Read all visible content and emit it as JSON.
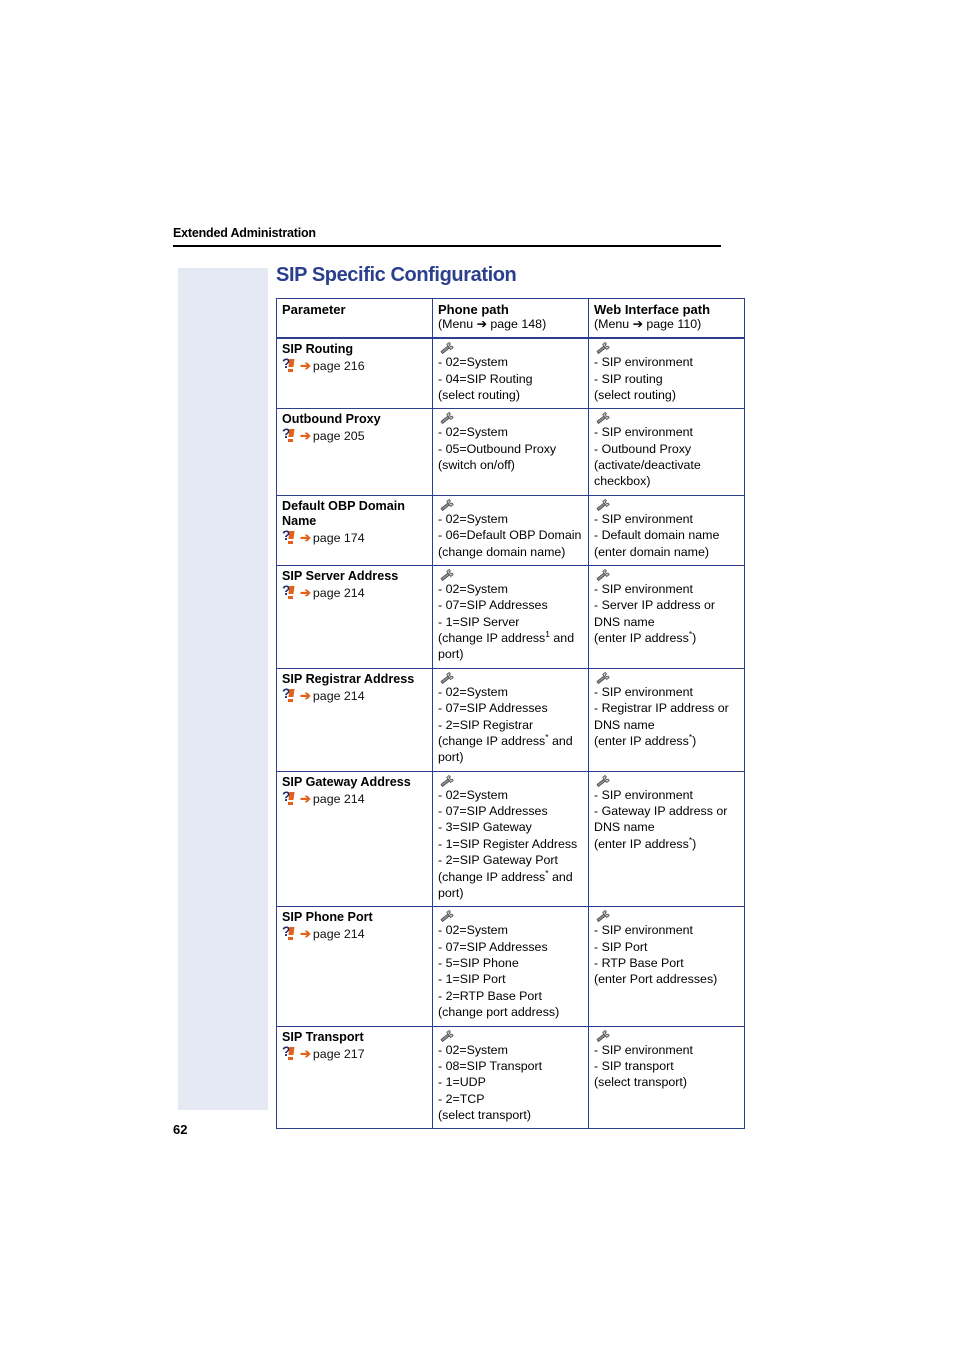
{
  "running_head": "Extended Administration",
  "section_title": "SIP Specific Configuration",
  "folio": "62",
  "colors": {
    "heading_blue": "#2b3f8c",
    "table_border": "#2b3f8c",
    "sidebar_band": "#e5e9f3",
    "accent_orange": "#e2621b"
  },
  "table": {
    "headers": {
      "parameter": "Parameter",
      "phone_path_title": "Phone path",
      "phone_path_sub": "(Menu ➔ page 148)",
      "web_path_title": "Web Interface path",
      "web_path_sub": "(Menu ➔ page 110)"
    },
    "rows": [
      {
        "parameter": "SIP Routing",
        "ref_page": "page 216",
        "phone_lines": [
          "- 02=System",
          "- 04=SIP Routing",
          "(select routing)"
        ],
        "web_lines": [
          "- SIP environment",
          "- SIP routing",
          "(select routing)"
        ]
      },
      {
        "parameter": "Outbound Proxy",
        "ref_page": "page 205",
        "phone_lines": [
          "- 02=System",
          "- 05=Outbound Proxy",
          "(switch on/off)"
        ],
        "web_lines": [
          "- SIP environment",
          "- Outbound Proxy",
          "(activate/deactivate checkbox)"
        ]
      },
      {
        "parameter": "Default OBP Domain Name",
        "ref_page": "page 174",
        "phone_lines": [
          "- 02=System",
          "- 06=Default OBP Domain",
          "(change domain name)"
        ],
        "web_lines": [
          "- SIP environment",
          "- Default domain name",
          "(enter domain name)"
        ]
      },
      {
        "parameter": "SIP Server Address",
        "ref_page": "page 214",
        "phone_lines": [
          "- 02=System",
          "- 07=SIP Addresses",
          "- 1=SIP Server",
          "(change IP address¹ and port)"
        ],
        "web_lines": [
          "- SIP environment",
          "- Server IP address or DNS name",
          "(enter IP address*)"
        ]
      },
      {
        "parameter": "SIP Registrar Address",
        "ref_page": "page 214",
        "phone_lines": [
          "- 02=System",
          "- 07=SIP Addresses",
          "- 2=SIP Registrar",
          "(change IP address* and port)"
        ],
        "web_lines": [
          "- SIP environment",
          "- Registrar IP address or DNS name",
          "(enter IP address*)"
        ]
      },
      {
        "parameter": "SIP Gateway Address",
        "ref_page": "page 214",
        "phone_lines": [
          "- 02=System",
          "- 07=SIP Addresses",
          "- 3=SIP Gateway",
          "- 1=SIP Register Address",
          "- 2=SIP Gateway Port",
          "(change IP address* and port)"
        ],
        "web_lines": [
          "- SIP environment",
          "- Gateway IP address or DNS name",
          "(enter IP address*)"
        ]
      },
      {
        "parameter": "SIP Phone Port",
        "ref_page": "page 214",
        "phone_lines": [
          "- 02=System",
          "- 07=SIP Addresses",
          "- 5=SIP Phone",
          "- 1=SIP Port",
          "- 2=RTP Base Port",
          "(change port address)"
        ],
        "web_lines": [
          "- SIP environment",
          "- SIP Port",
          "- RTP Base Port",
          "(enter Port addresses)"
        ]
      },
      {
        "parameter": "SIP Transport",
        "ref_page": "page 217",
        "phone_lines": [
          "- 02=System",
          "- 08=SIP Transport",
          "- 1=UDP",
          "- 2=TCP",
          "(select transport)"
        ],
        "web_lines": [
          "- SIP environment",
          "- SIP transport",
          "(select transport)"
        ]
      }
    ]
  }
}
